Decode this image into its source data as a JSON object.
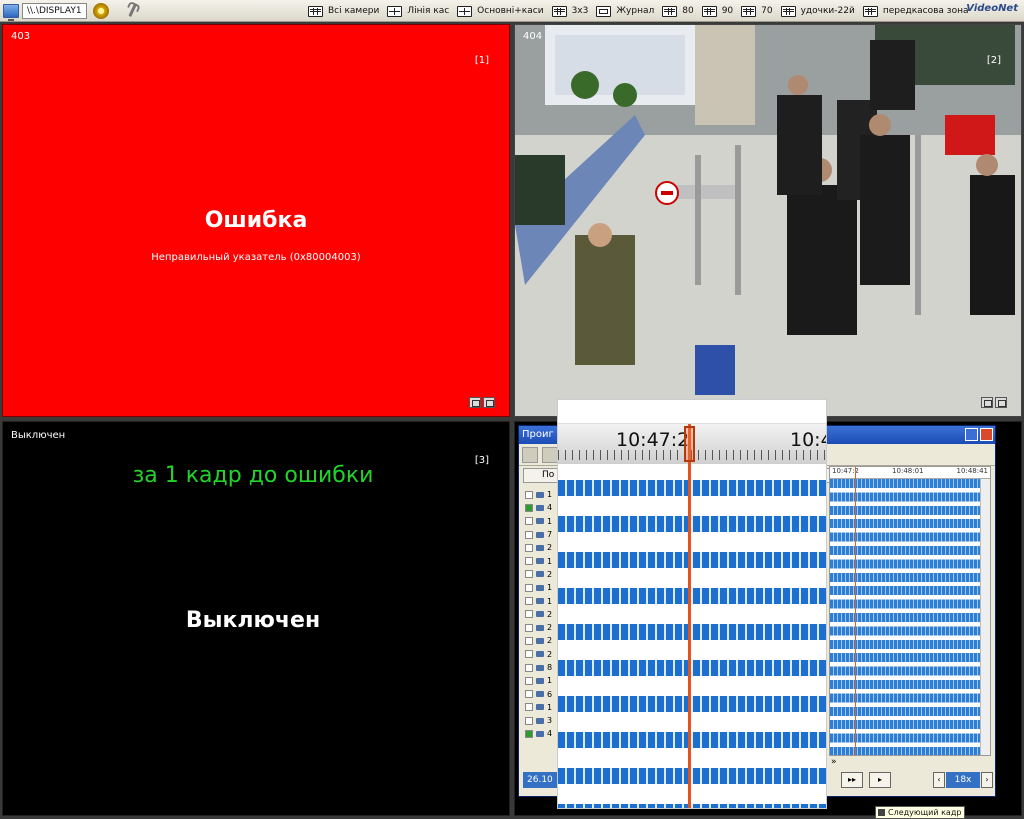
{
  "toolbar": {
    "display": "\\\\.\\DISPLAY1",
    "presets": [
      "Всі камери",
      "Лінія кас",
      "Основні+каси",
      "3x3",
      "Журнал",
      "80",
      "90",
      "70",
      "удочки-22й",
      "передкасова зона"
    ],
    "brand": "VideoNet"
  },
  "cells": [
    {
      "id": "403",
      "index": "[1]",
      "title": "Ошибка",
      "message": "Неправильный указатель (0x80004003)",
      "color": "#ff0000"
    },
    {
      "id": "404",
      "index": "[2]"
    },
    {
      "id": "Выключен",
      "index": "[3]",
      "note": "за 1 кадр до ошибки",
      "status": "Выключен",
      "note_color": "#22d42a"
    }
  ],
  "player": {
    "title": "Проиг",
    "list_header": "По",
    "rows": [
      {
        "n": "1",
        "checked": false
      },
      {
        "n": "4",
        "checked": true
      },
      {
        "n": "1",
        "checked": false
      },
      {
        "n": "7",
        "checked": false
      },
      {
        "n": "2",
        "checked": false
      },
      {
        "n": "1",
        "checked": false
      },
      {
        "n": "2",
        "checked": false
      },
      {
        "n": "1",
        "checked": false
      },
      {
        "n": "1",
        "checked": false
      },
      {
        "n": "2",
        "checked": false
      },
      {
        "n": "2",
        "checked": false
      },
      {
        "n": "2",
        "checked": false
      },
      {
        "n": "2",
        "checked": false
      },
      {
        "n": "8",
        "checked": false
      },
      {
        "n": "1",
        "checked": false
      },
      {
        "n": "6",
        "checked": false
      },
      {
        "n": "1",
        "checked": false
      },
      {
        "n": "3",
        "checked": false
      },
      {
        "n": "4",
        "checked": true
      }
    ],
    "timeline_labels": [
      "10:47:2",
      "10:48:01",
      "10:48:41"
    ],
    "date": "26.10",
    "speed": "18x",
    "btn_fwd": "▸▸",
    "btn_next": "▸"
  },
  "zoom": {
    "label_left": "10:47:2",
    "label_right": "10:4"
  },
  "tooltip": "Следующий кадр",
  "colors": {
    "accent": "#1c6fcf",
    "cursor": "#e1541c"
  }
}
